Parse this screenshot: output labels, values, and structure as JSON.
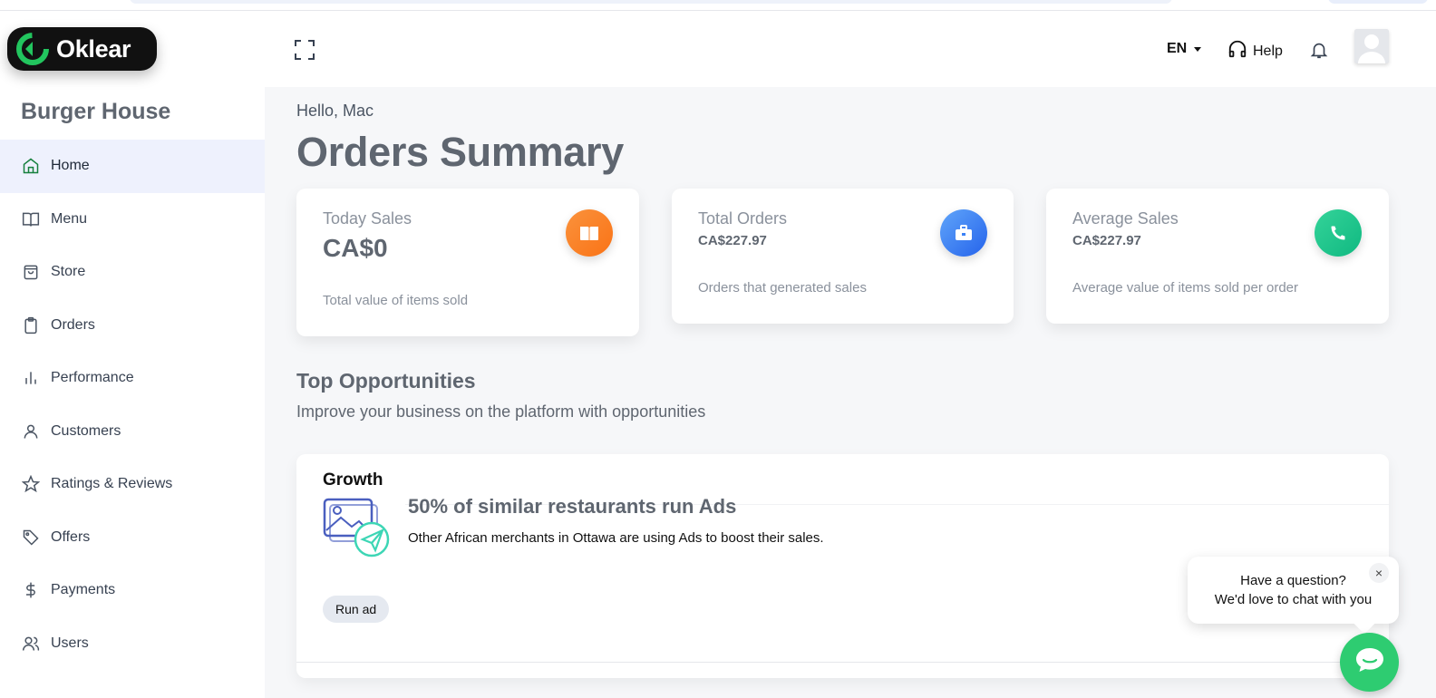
{
  "brand": {
    "name": "Oklear",
    "accent": "#22c55e"
  },
  "store": {
    "name": "Burger House"
  },
  "sidebar": {
    "items": [
      {
        "label": "Home",
        "icon": "home-icon",
        "active": true
      },
      {
        "label": "Menu",
        "icon": "book-open-icon"
      },
      {
        "label": "Store",
        "icon": "shopping-bag-icon"
      },
      {
        "label": "Orders",
        "icon": "clipboard-icon"
      },
      {
        "label": "Performance",
        "icon": "bar-chart-icon"
      },
      {
        "label": "Customers",
        "icon": "user-icon"
      },
      {
        "label": "Ratings & Reviews",
        "icon": "star-icon"
      },
      {
        "label": "Offers",
        "icon": "tag-icon"
      },
      {
        "label": "Payments",
        "icon": "dollar-icon"
      },
      {
        "label": "Users",
        "icon": "users-icon"
      }
    ]
  },
  "header": {
    "language": "EN",
    "help_label": "Help"
  },
  "main": {
    "greeting": "Hello, Mac",
    "title": "Orders Summary",
    "cards": [
      {
        "label": "Today Sales",
        "value": "CA$0",
        "description": "Total value of items sold",
        "icon": "book-icon",
        "color": "#f97316"
      },
      {
        "label": "Total Orders",
        "value": "CA$227.97",
        "description": "Orders that generated sales",
        "icon": "briefcase-icon",
        "color": "#3b82f6"
      },
      {
        "label": "Average Sales",
        "value": "CA$227.97",
        "description": "Average value of items sold per order",
        "icon": "phone-icon",
        "color": "#10b981"
      }
    ],
    "opportunities": {
      "title": "Top Opportunities",
      "subtitle": "Improve your business on the platform with opportunities",
      "item": {
        "tag": "Growth",
        "headline": "50% of similar restaurants run Ads",
        "body": "Other African merchants in Ottawa are using Ads to boost their sales.",
        "button": "Run ad"
      }
    }
  },
  "chat": {
    "line1": "Have a question?",
    "line2": "We'd love to chat with you",
    "close": "×"
  }
}
